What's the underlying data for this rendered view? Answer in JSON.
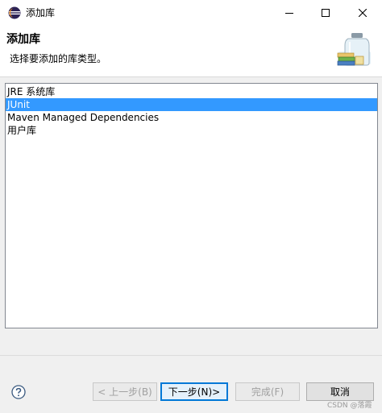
{
  "window": {
    "title": "添加库",
    "icon": "eclipse-icon"
  },
  "banner": {
    "title": "添加库",
    "description": "选择要添加的库类型。",
    "image": "library-jar-icon"
  },
  "library_types": [
    {
      "label": "JRE 系统库",
      "selected": false
    },
    {
      "label": "JUnit",
      "selected": true
    },
    {
      "label": "Maven Managed Dependencies",
      "selected": false
    },
    {
      "label": "用户库",
      "selected": false
    }
  ],
  "buttons": {
    "back": "< 上一步(B)",
    "next": "下一步(N)>",
    "finish": "完成(F)",
    "cancel": "取消"
  },
  "watermark": "CSDN @落霞",
  "colors": {
    "selection": "#3399ff",
    "default_button_border": "#0078d7"
  }
}
